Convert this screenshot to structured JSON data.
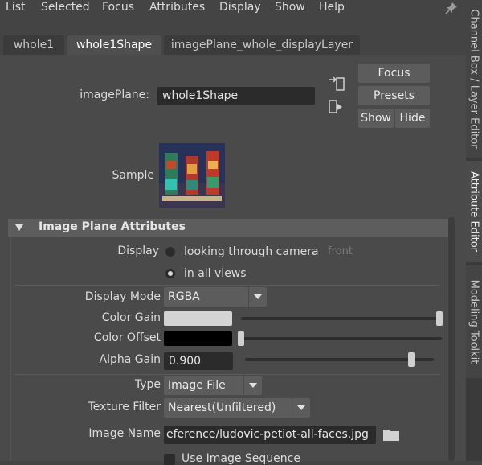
{
  "menu": [
    "List",
    "Selected",
    "Focus",
    "Attributes",
    "Display",
    "Show",
    "Help"
  ],
  "side_tabs": [
    "Channel Box / Layer Editor",
    "Attribute Editor",
    "Modeling Toolkit"
  ],
  "tabs": [
    "whole1",
    "whole1Shape",
    "imagePlane_whole_displayLayer"
  ],
  "header": {
    "imageplane_label": "imagePlane:",
    "imageplane_value": "whole1Shape",
    "focus": "Focus",
    "presets": "Presets",
    "show": "Show",
    "hide": "Hide",
    "sample_label": "Sample"
  },
  "section": {
    "title": "Image Plane Attributes",
    "display_label": "Display",
    "display_opt1": "looking through camera",
    "display_opt1_camera": "front",
    "display_opt2": "in all views",
    "display_selected": "in all views",
    "display_mode_label": "Display Mode",
    "display_mode_value": "RGBA",
    "color_gain_label": "Color Gain",
    "color_offset_label": "Color Offset",
    "alpha_gain_label": "Alpha Gain",
    "alpha_gain_value": "0.900",
    "type_label": "Type",
    "type_value": "Image File",
    "texture_filter_label": "Texture Filter",
    "texture_filter_value": "Nearest(Unfiltered)",
    "image_name_label": "Image Name",
    "image_name_value": "eference/ludovic-petiot-all-faces.jpg",
    "use_sequence_label": "Use Image Sequence"
  },
  "colors": {
    "color_gain": "#d4d4d4",
    "color_offset": "#000000"
  },
  "icons": [
    "pin-icon",
    "input-connection-icon",
    "output-connection-icon",
    "collapse-triangle-icon",
    "folder-icon",
    "chevron-down-icon"
  ]
}
